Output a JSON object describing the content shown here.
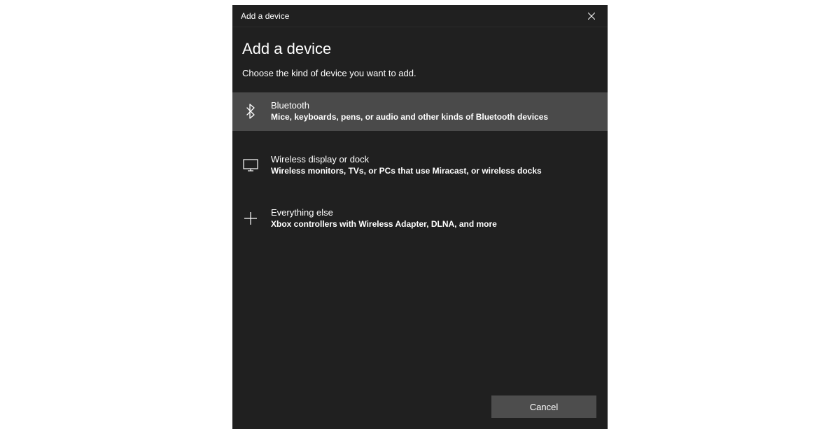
{
  "titlebar": {
    "text": "Add a device"
  },
  "header": {
    "title": "Add a device",
    "subtitle": "Choose the kind of device you want to add."
  },
  "options": [
    {
      "title": "Bluetooth",
      "description": "Mice, keyboards, pens, or audio and other kinds of Bluetooth devices"
    },
    {
      "title": "Wireless display or dock",
      "description": "Wireless monitors, TVs, or PCs that use Miracast, or wireless docks"
    },
    {
      "title": "Everything else",
      "description": "Xbox controllers with Wireless Adapter, DLNA, and more"
    }
  ],
  "footer": {
    "cancel_label": "Cancel"
  }
}
